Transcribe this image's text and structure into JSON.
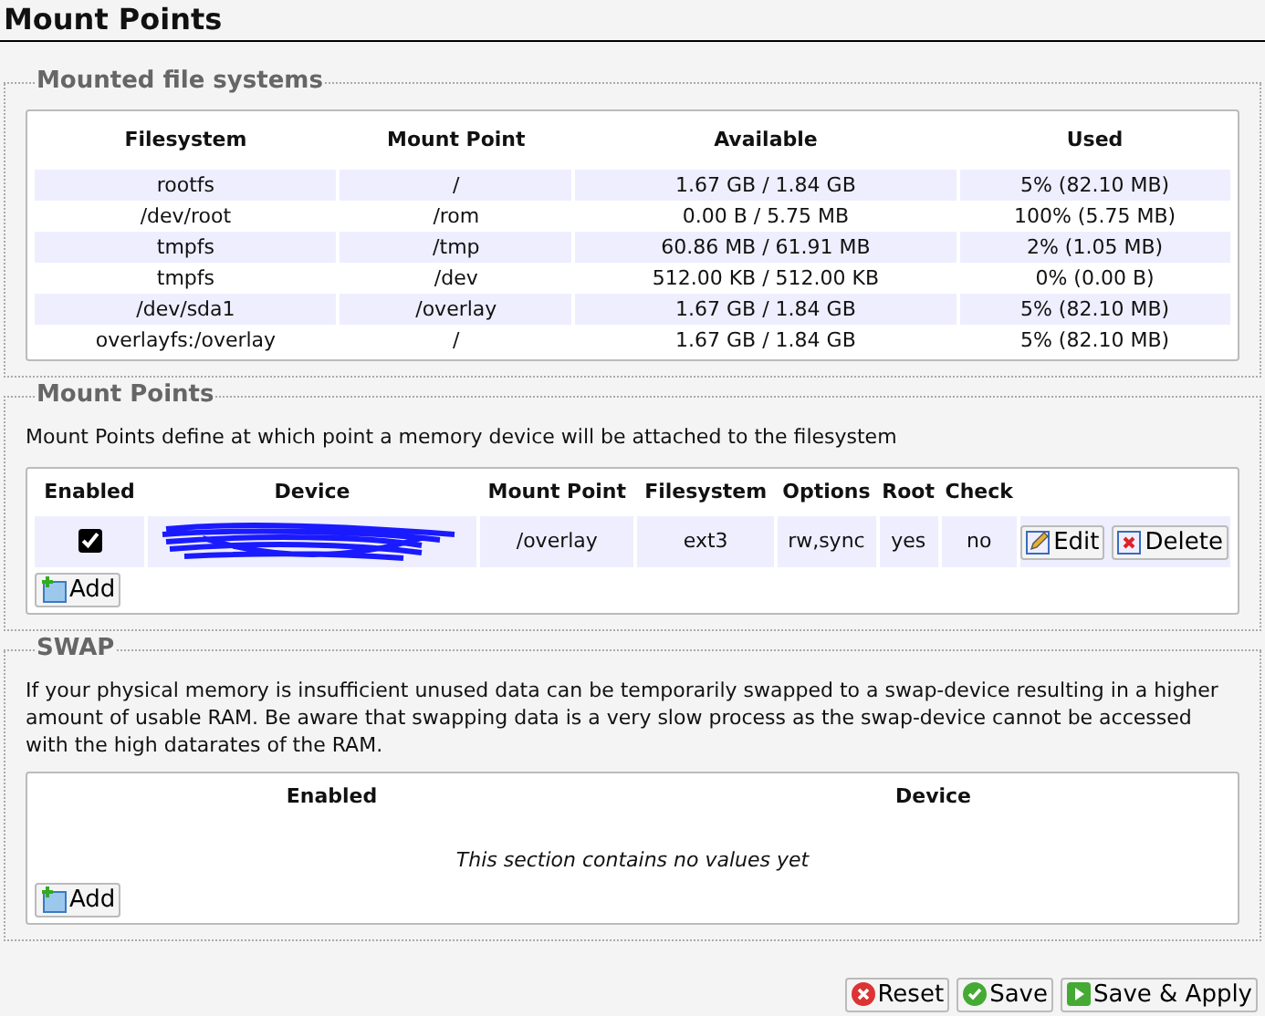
{
  "page_title": "Mount Points",
  "mounted": {
    "legend": "Mounted file systems",
    "columns": [
      "Filesystem",
      "Mount Point",
      "Available",
      "Used"
    ],
    "rows": [
      {
        "filesystem": "rootfs",
        "mount_point": "/",
        "available": "1.67 GB / 1.84 GB",
        "used": "5% (82.10 MB)"
      },
      {
        "filesystem": "/dev/root",
        "mount_point": "/rom",
        "available": "0.00 B / 5.75 MB",
        "used": "100% (5.75 MB)"
      },
      {
        "filesystem": "tmpfs",
        "mount_point": "/tmp",
        "available": "60.86 MB / 61.91 MB",
        "used": "2% (1.05 MB)"
      },
      {
        "filesystem": "tmpfs",
        "mount_point": "/dev",
        "available": "512.00 KB / 512.00 KB",
        "used": "0% (0.00 B)"
      },
      {
        "filesystem": "/dev/sda1",
        "mount_point": "/overlay",
        "available": "1.67 GB / 1.84 GB",
        "used": "5% (82.10 MB)"
      },
      {
        "filesystem": "overlayfs:/overlay",
        "mount_point": "/",
        "available": "1.67 GB / 1.84 GB",
        "used": "5% (82.10 MB)"
      }
    ]
  },
  "mount_points": {
    "legend": "Mount Points",
    "description": "Mount Points define at which point a memory device will be attached to the filesystem",
    "columns": [
      "Enabled",
      "Device",
      "Mount Point",
      "Filesystem",
      "Options",
      "Root",
      "Check"
    ],
    "rows": [
      {
        "enabled": true,
        "mount_point": "/overlay",
        "filesystem": "ext3",
        "options": "rw,sync",
        "root": "yes",
        "check": "no",
        "edit": "Edit",
        "delete": "Delete"
      }
    ],
    "add": "Add"
  },
  "swap": {
    "legend": "SWAP",
    "description": "If your physical memory is insufficient unused data can be temporarily swapped to a swap-device resulting in a higher amount of usable RAM. Be aware that swapping data is a very slow process as the swap-device cannot be accessed with the high datarates of the RAM.",
    "columns": [
      "Enabled",
      "Device"
    ],
    "empty": "This section contains no values yet",
    "add": "Add"
  },
  "buttons": [
    {
      "kind": "reset",
      "label": "Reset"
    },
    {
      "kind": "save",
      "label": "Save"
    },
    {
      "kind": "apply",
      "label": "Save & Apply"
    }
  ]
}
